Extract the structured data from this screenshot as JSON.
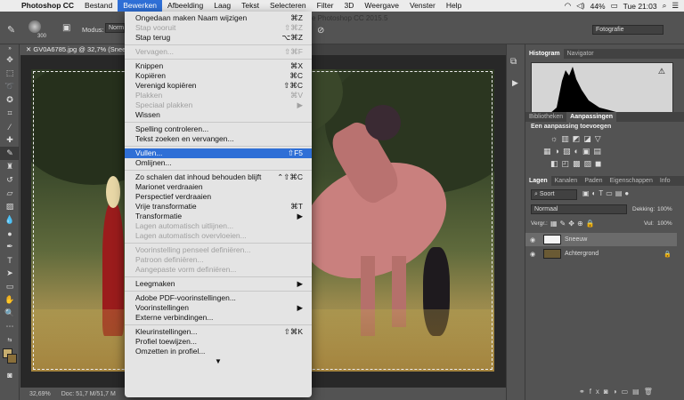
{
  "menubar": {
    "app": "Photoshop CC",
    "items": [
      "Bestand",
      "Bewerken",
      "Afbeelding",
      "Laag",
      "Tekst",
      "Selecteren",
      "Filter",
      "3D",
      "Weergave",
      "Venster",
      "Help"
    ],
    "active_item": "Bewerken",
    "battery": "44%",
    "clock": "Tue 21:03"
  },
  "options_bar": {
    "brush_size": "300",
    "mode_label": "Modus:",
    "mode_value": "Norm",
    "window_title_fragment": "e Photoshop CC 2015.5",
    "workspace": "Fotografie"
  },
  "document": {
    "tab_title": "GV0A6785.jpg @ 32,7% (Snee",
    "zoom": "32,69%",
    "doc_info": "Doc: 51,7 M/51,7 M"
  },
  "edit_menu": {
    "items": [
      {
        "label": "Ongedaan maken Naam wijzigen",
        "shortcut": "⌘Z",
        "disabled": false
      },
      {
        "label": "Stap vooruit",
        "shortcut": "⇧⌘Z",
        "disabled": true
      },
      {
        "label": "Stap terug",
        "shortcut": "⌥⌘Z",
        "disabled": false
      },
      {
        "sep": true
      },
      {
        "label": "Vervagen...",
        "shortcut": "⇧⌘F",
        "disabled": true
      },
      {
        "sep": true
      },
      {
        "label": "Knippen",
        "shortcut": "⌘X",
        "disabled": false
      },
      {
        "label": "Kopiëren",
        "shortcut": "⌘C",
        "disabled": false
      },
      {
        "label": "Verenigd kopiëren",
        "shortcut": "⇧⌘C",
        "disabled": false
      },
      {
        "label": "Plakken",
        "shortcut": "⌘V",
        "disabled": true
      },
      {
        "label": "Speciaal plakken",
        "shortcut": "▶",
        "disabled": true
      },
      {
        "label": "Wissen",
        "shortcut": "",
        "disabled": false
      },
      {
        "sep": true
      },
      {
        "label": "Spelling controleren...",
        "shortcut": "",
        "disabled": false
      },
      {
        "label": "Tekst zoeken en vervangen...",
        "shortcut": "",
        "disabled": false
      },
      {
        "sep": true
      },
      {
        "label": "Vullen...",
        "shortcut": "⇧F5",
        "disabled": false,
        "highlighted": true
      },
      {
        "label": "Omlijnen...",
        "shortcut": "",
        "disabled": false
      },
      {
        "sep": true
      },
      {
        "label": "Zo schalen dat inhoud behouden blijft",
        "shortcut": "⌃⇧⌘C",
        "disabled": false
      },
      {
        "label": "Marionet verdraaien",
        "shortcut": "",
        "disabled": false
      },
      {
        "label": "Perspectief verdraaien",
        "shortcut": "",
        "disabled": false
      },
      {
        "label": "Vrije transformatie",
        "shortcut": "⌘T",
        "disabled": false
      },
      {
        "label": "Transformatie",
        "shortcut": "▶",
        "disabled": false
      },
      {
        "label": "Lagen automatisch uitlijnen...",
        "shortcut": "",
        "disabled": true
      },
      {
        "label": "Lagen automatisch overvloeien...",
        "shortcut": "",
        "disabled": true
      },
      {
        "sep": true
      },
      {
        "label": "Voorinstelling penseel definiëren...",
        "shortcut": "",
        "disabled": true
      },
      {
        "label": "Patroon definiëren...",
        "shortcut": "",
        "disabled": true
      },
      {
        "label": "Aangepaste vorm definiëren...",
        "shortcut": "",
        "disabled": true
      },
      {
        "sep": true
      },
      {
        "label": "Leegmaken",
        "shortcut": "▶",
        "disabled": false
      },
      {
        "sep": true
      },
      {
        "label": "Adobe PDF-voorinstellingen...",
        "shortcut": "",
        "disabled": false
      },
      {
        "label": "Voorinstellingen",
        "shortcut": "▶",
        "disabled": false
      },
      {
        "label": "Externe verbindingen...",
        "shortcut": "",
        "disabled": false
      },
      {
        "sep": true
      },
      {
        "label": "Kleurinstellingen...",
        "shortcut": "⇧⌘K",
        "disabled": false
      },
      {
        "label": "Profiel toewijzen...",
        "shortcut": "",
        "disabled": false
      },
      {
        "label": "Omzetten in profiel...",
        "shortcut": "",
        "disabled": false
      }
    ],
    "more_arrow": "▼"
  },
  "panels": {
    "top_tabs": [
      "Histogram",
      "Navigator"
    ],
    "adjust_tabs": [
      "Bibliotheken",
      "Aanpassingen"
    ],
    "adjust_caption": "Een aanpassing toevoegen",
    "layer_tabs": [
      "Lagen",
      "Kanalen",
      "Paden",
      "Eigenschappen",
      "Info"
    ],
    "filter": "Soort",
    "blend_mode": "Normaal",
    "opacity_label": "Dekking:",
    "opacity_value": "100%",
    "lock_label": "Vergr.:",
    "fill_label": "Vul:",
    "fill_value": "100%",
    "layers": [
      {
        "name": "Sneeuw",
        "selected": true
      },
      {
        "name": "Achtergrond",
        "selected": false
      }
    ]
  }
}
